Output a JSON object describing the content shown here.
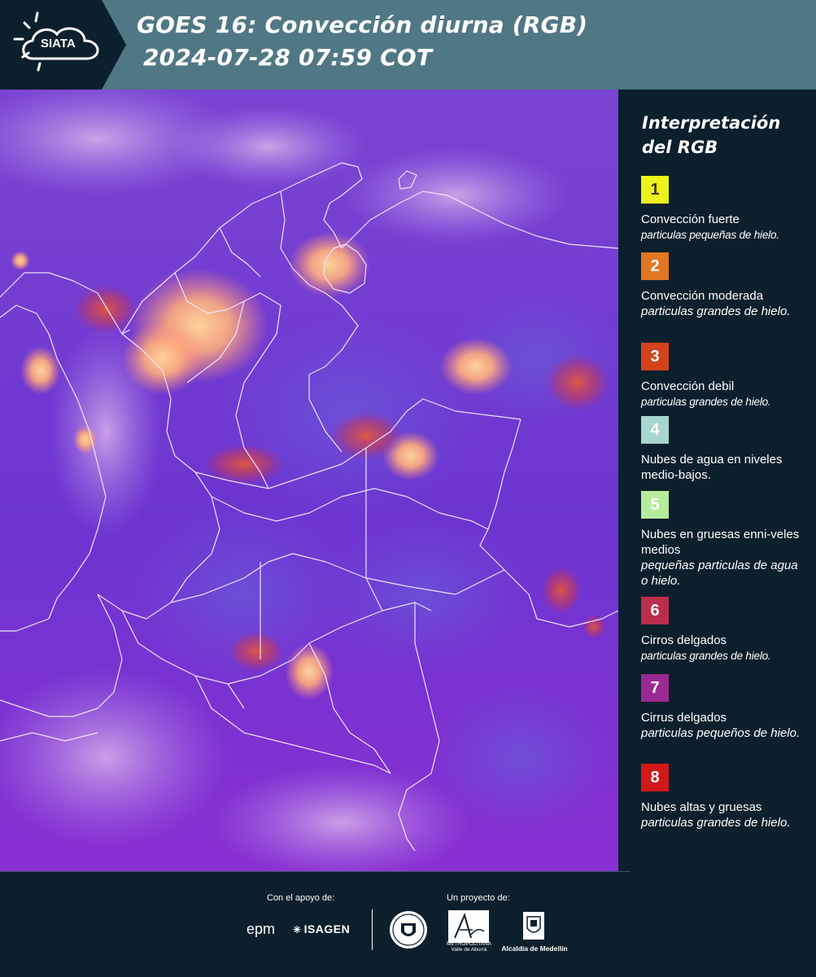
{
  "header": {
    "logo_text": "SIATA",
    "title_line1": "GOES 16: Convección diurna (RGB)",
    "title_line2": "2024-07-28 07:59 COT",
    "background_color": "#507784"
  },
  "map": {
    "description_hidden": false,
    "background_color": "#6d2bd0"
  },
  "legend": {
    "title": "Interpretación del RGB",
    "items": [
      {
        "number": "1",
        "color": "#ecf21c",
        "text_color": "#3a3a00",
        "label": "Convección fuerte",
        "desc": "particulas pequeñas de hielo."
      },
      {
        "number": "2",
        "color": "#e17722",
        "text_color": "#ffffff",
        "label": "Convección moderada",
        "desc": "particulas grandes de hielo."
      },
      {
        "number": "3",
        "color": "#d2431b",
        "text_color": "#ffffff",
        "label": "Convección debil",
        "desc": "particulas grandes de hielo."
      },
      {
        "number": "4",
        "color": "#a9d5d0",
        "text_color": "#ffffff",
        "label": "Nubes de agua en niveles medio-bajos.",
        "desc": ""
      },
      {
        "number": "5",
        "color": "#b6ec9c",
        "text_color": "#ffffff",
        "label": "Nubes en gruesas enni-veles medios",
        "desc": "pequeñas particulas de agua o hielo."
      },
      {
        "number": "6",
        "color": "#bb2e4b",
        "text_color": "#ffffff",
        "label": "Cirros delgados",
        "desc": "particulas grandes de hielo."
      },
      {
        "number": "7",
        "color": "#9a2a93",
        "text_color": "#ffffff",
        "label": "Cirrus delgados",
        "desc": "particulas pequeños de hielo."
      },
      {
        "number": "8",
        "color": "#d1191a",
        "text_color": "#ffffff",
        "label": "Nubes altas y gruesas",
        "desc": "particulas grandes de hielo."
      }
    ]
  },
  "footer": {
    "support_label": "Con el apoyo de:",
    "project_label": "Un proyecto de:",
    "epm": "epm",
    "isagen": "ISAGEN",
    "area_text": "METROPOLITANA Valle de Aburrá",
    "alcaldia_text": "Alcaldía de Medellín"
  }
}
